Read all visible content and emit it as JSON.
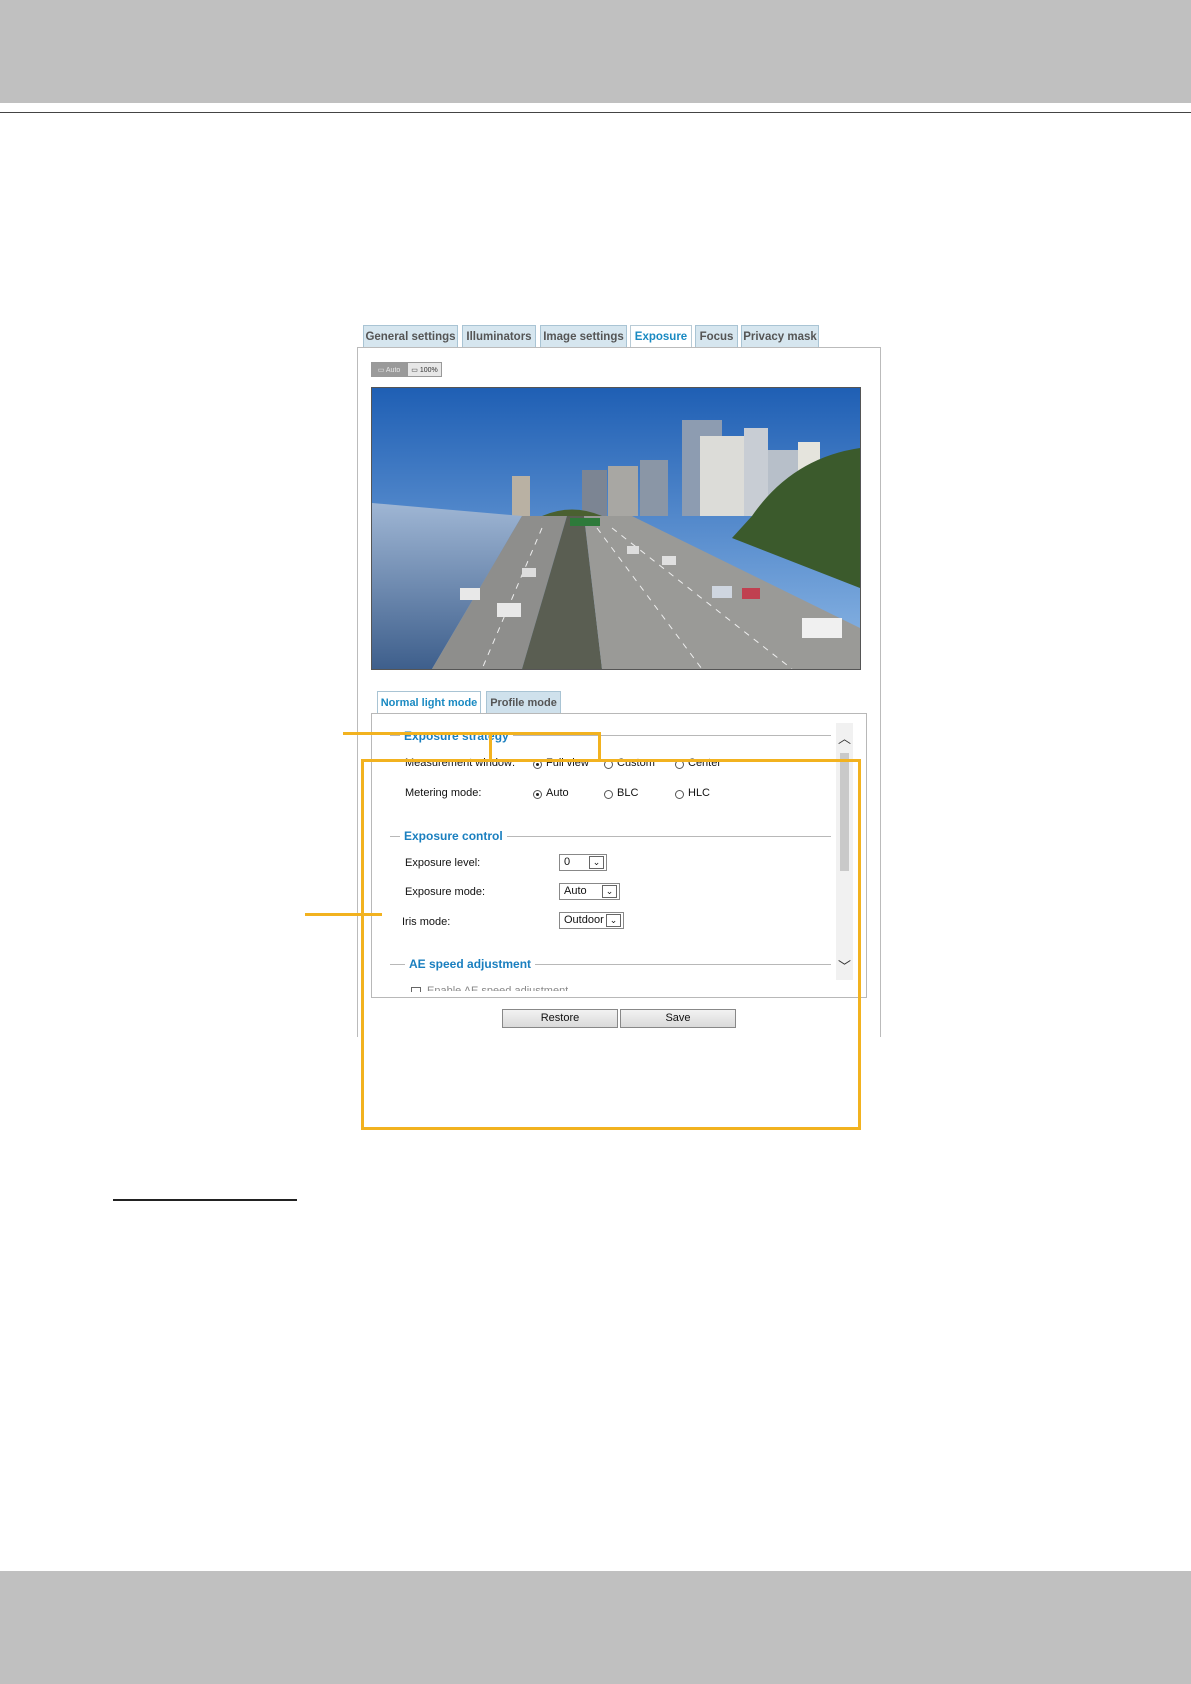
{
  "tabs": [
    {
      "label": "General settings"
    },
    {
      "label": "Illuminators"
    },
    {
      "label": "Image settings"
    },
    {
      "label": "Exposure"
    },
    {
      "label": "Focus"
    },
    {
      "label": "Privacy mask"
    }
  ],
  "active_tab": "Exposure",
  "zoom": {
    "auto_label": "Auto",
    "pct_label": "100%"
  },
  "subtabs": [
    {
      "label": "Normal light mode"
    },
    {
      "label": "Profile mode"
    }
  ],
  "exposure_strategy": {
    "title": "Exposure strategy",
    "measurement_label": "Measurement window:",
    "measurement_options": [
      "Full view",
      "Custom",
      "Center"
    ],
    "measurement_selected": "Full view",
    "metering_label": "Metering mode:",
    "metering_options": [
      "Auto",
      "BLC",
      "HLC"
    ],
    "metering_selected": "Auto"
  },
  "exposure_control": {
    "title": "Exposure control",
    "level_label": "Exposure level:",
    "level_value": "0",
    "mode_label": "Exposure mode:",
    "mode_value": "Auto",
    "iris_label": "Iris mode:",
    "iris_value": "Outdoor"
  },
  "ae_speed": {
    "title": "AE speed adjustment",
    "checkbox_label": "Enable AE speed adjustment"
  },
  "buttons": {
    "restore": "Restore",
    "save": "Save"
  },
  "colors": {
    "accent": "#1a8ac2",
    "callout": "#f2b21f",
    "band": "#c0c0c0"
  }
}
